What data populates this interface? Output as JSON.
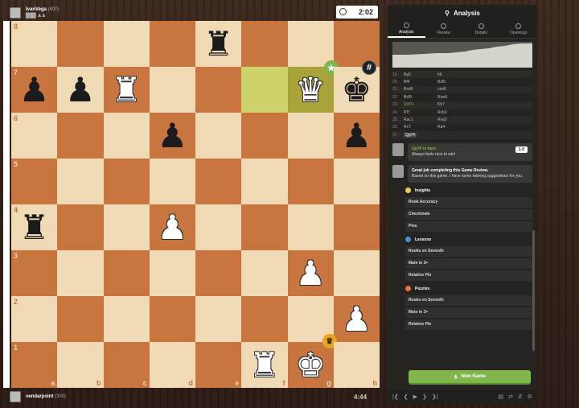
{
  "top_player": {
    "name": "IvanVega",
    "rating": "(400)",
    "flags": "███ ♟♟",
    "clock": "2:02"
  },
  "bottom_player": {
    "name": "vendarpoint",
    "rating": "(350)",
    "clock": "4:44"
  },
  "board": {
    "ranks": [
      "8",
      "7",
      "6",
      "5",
      "4",
      "3",
      "2",
      "1"
    ],
    "files": [
      "a",
      "b",
      "c",
      "d",
      "e",
      "f",
      "g",
      "h"
    ],
    "rows": [
      [
        "",
        "",
        "",
        "",
        "bR",
        "",
        "",
        ""
      ],
      [
        "bP",
        "bP",
        "wR",
        "",
        "",
        "",
        "wQ",
        "bK"
      ],
      [
        "",
        "",
        "",
        "bP",
        "",
        "",
        "",
        "bP"
      ],
      [
        "",
        "",
        "",
        "",
        "",
        "",
        "",
        ""
      ],
      [
        "bR",
        "",
        "",
        "wP",
        "",
        "",
        "",
        ""
      ],
      [
        "",
        "",
        "",
        "",
        "",
        "",
        "wP",
        ""
      ],
      [
        "",
        "",
        "",
        "",
        "",
        "",
        "",
        "wP"
      ],
      [
        "",
        "",
        "",
        "",
        "",
        "wR",
        "wK",
        ""
      ]
    ],
    "highlights": [
      "f7",
      "g7"
    ],
    "best_move_square": "g7",
    "checkmate_square": "h7",
    "winner_square": "g1"
  },
  "panel": {
    "title": "Analysis",
    "tabs": [
      "Analysis",
      "Review",
      "Details",
      "Openings"
    ],
    "active_tab": "Analysis",
    "moves": [
      {
        "n": "19.",
        "w": "Bg5",
        "b": "h6"
      },
      {
        "n": "20.",
        "w": "Bf4",
        "b": "Bxf5"
      },
      {
        "n": "21.",
        "w": "Bxd6",
        "b": "cxd6"
      },
      {
        "n": "22.",
        "w": "Bxf5",
        "b": "Rae8"
      },
      {
        "n": "23.",
        "w": "Qxf7+",
        "b": "Kh7"
      },
      {
        "n": "24.",
        "w": "Rf7",
        "b": "Rxb2"
      },
      {
        "n": "25.",
        "w": "Rac1",
        "b": "Rxa2"
      },
      {
        "n": "26.",
        "w": "Rc7",
        "b": "Ra4"
      },
      {
        "n": "27.",
        "w": "Qg7#",
        "b": ""
      }
    ],
    "coach1": {
      "best_text": "Qg7# is best",
      "eval": "1-0",
      "message": "Always feels nice to win!"
    },
    "coach2": {
      "headline": "Great job completing this Game Review.",
      "body": "Based on this game, I have some training suggestions for you."
    },
    "insights": {
      "title": "Insights",
      "items": [
        "Rook Accuracy",
        "Checkmate",
        "Pins"
      ]
    },
    "lessons": {
      "title": "Lessons",
      "items": [
        "Rooks on Seventh",
        "Mate in 3+",
        "Relative Pin"
      ]
    },
    "puzzles": {
      "title": "Puzzles",
      "items": [
        "Rooks on Seventh",
        "Mate in 3+",
        "Relative Pin"
      ]
    },
    "new_game_label": "New Game"
  },
  "colors": {
    "light_square": "#f0d9b5",
    "dark_square": "#c8753f",
    "accent_green": "#81b64c",
    "panel_bg": "#262421"
  }
}
